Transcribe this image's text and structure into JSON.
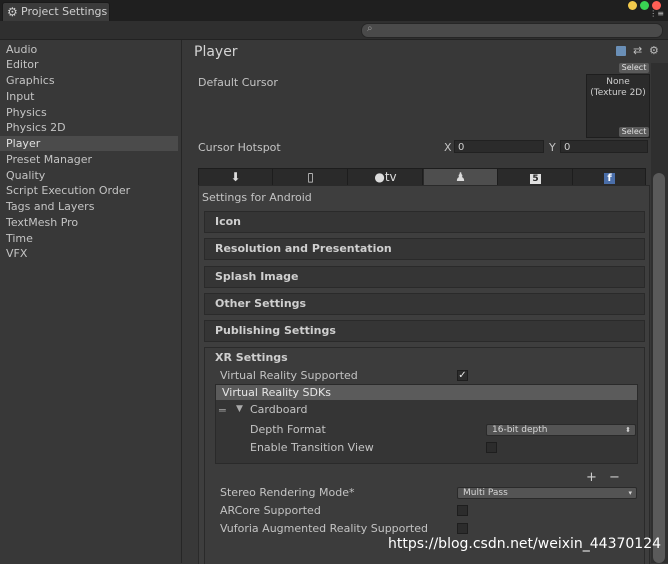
{
  "window": {
    "tab_label": "Project Settings",
    "button_colors": [
      "#f2c94c",
      "#39d353",
      "#ff5f56"
    ]
  },
  "sidebar": {
    "items": [
      {
        "label": "Audio"
      },
      {
        "label": "Editor"
      },
      {
        "label": "Graphics"
      },
      {
        "label": "Input"
      },
      {
        "label": "Physics"
      },
      {
        "label": "Physics 2D"
      },
      {
        "label": "Player",
        "selected": true
      },
      {
        "label": "Preset Manager"
      },
      {
        "label": "Quality"
      },
      {
        "label": "Script Execution Order"
      },
      {
        "label": "Tags and Layers"
      },
      {
        "label": "TextMesh Pro"
      },
      {
        "label": "Time"
      },
      {
        "label": "VFX"
      }
    ]
  },
  "main": {
    "title": "Player",
    "default_cursor_label": "Default Cursor",
    "default_cursor_value": "None (Texture 2D)",
    "select_label": "Select",
    "cursor_hotspot_label": "Cursor Hotspot",
    "hotspot_x_label": "X",
    "hotspot_x_value": "0",
    "hotspot_y_label": "Y",
    "hotspot_y_value": "0",
    "platform_tabs": [
      "standalone-icon",
      "ios-icon",
      "appletv-icon",
      "android-icon",
      "html5-icon",
      "facebook-icon"
    ],
    "appletv_text": "tv",
    "selected_platform": "android-icon",
    "settings_for_label": "Settings for Android",
    "sections": [
      "Icon",
      "Resolution and Presentation",
      "Splash Image",
      "Other Settings",
      "Publishing Settings"
    ],
    "xr": {
      "title": "XR Settings",
      "vr_supported_label": "Virtual Reality Supported",
      "vr_supported": true,
      "sdks_header": "Virtual Reality SDKs",
      "sdk_name": "Cardboard",
      "depth_format_label": "Depth Format",
      "depth_format_value": "16-bit depth",
      "enable_transition_label": "Enable Transition View",
      "enable_transition": false,
      "add_symbol": "+",
      "remove_symbol": "−",
      "stereo_mode_label": "Stereo Rendering Mode*",
      "stereo_mode_value": "Multi Pass",
      "arcore_label": "ARCore Supported",
      "arcore": false,
      "vuforia_label": "Vuforia Augmented Reality Supported",
      "vuforia": false
    }
  },
  "watermark": "https://blog.csdn.net/weixin_44370124"
}
